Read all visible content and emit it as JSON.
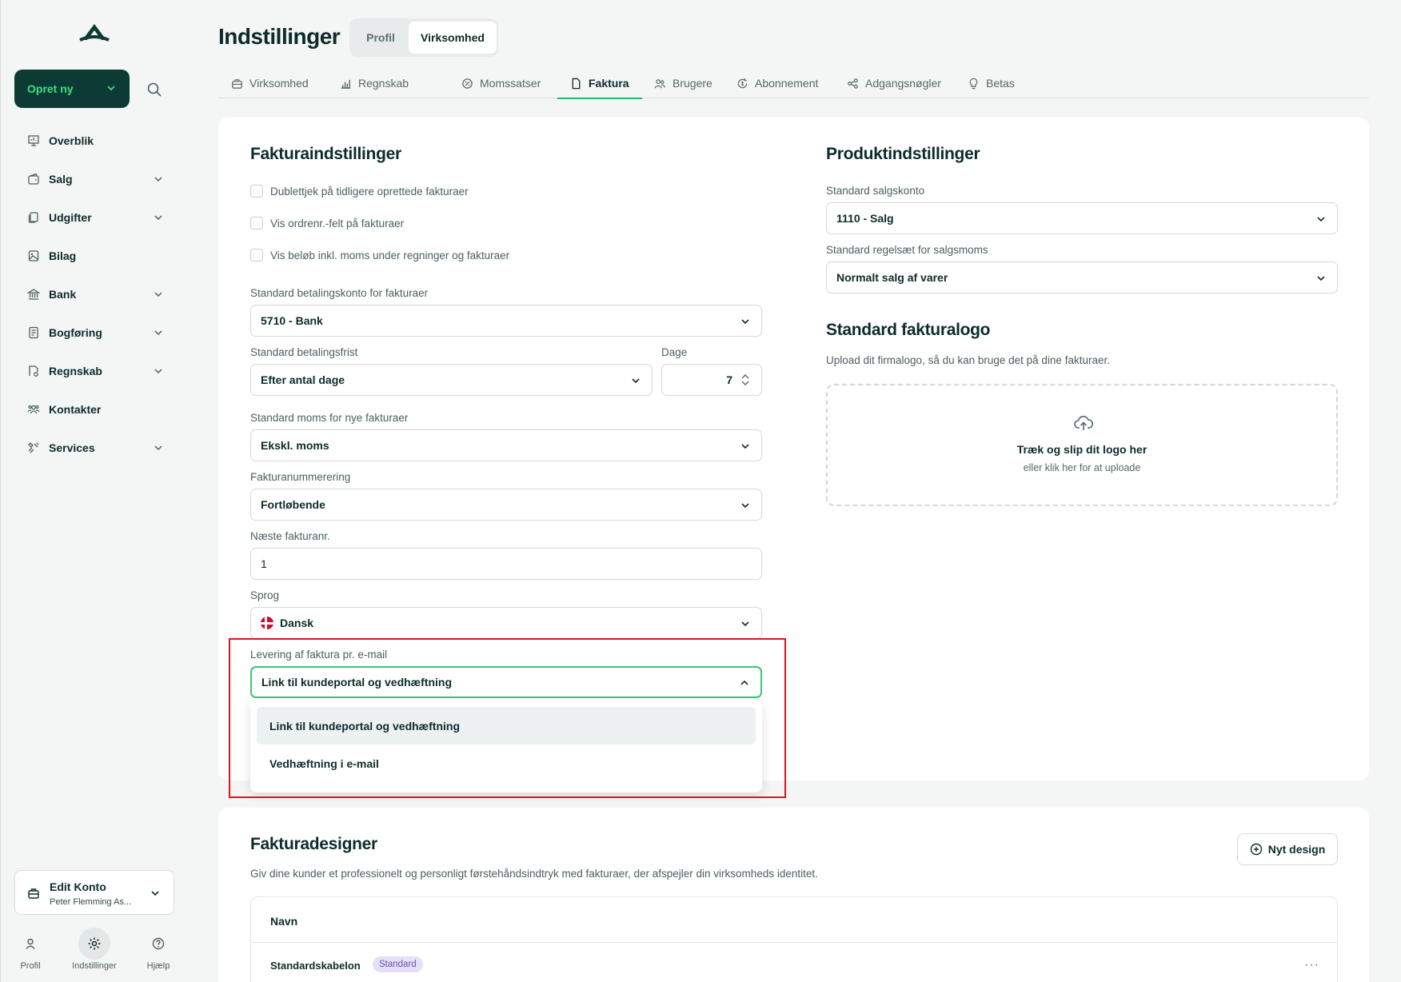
{
  "sidebar": {
    "create_label": "Opret ny",
    "items": [
      {
        "label": "Overblik",
        "icon": "presentation-icon",
        "has_chevron": false
      },
      {
        "label": "Salg",
        "icon": "wallet-icon",
        "has_chevron": true
      },
      {
        "label": "Udgifter",
        "icon": "receipt-icon",
        "has_chevron": true
      },
      {
        "label": "Bilag",
        "icon": "document-image-icon",
        "has_chevron": false
      },
      {
        "label": "Bank",
        "icon": "bank-icon",
        "has_chevron": true
      },
      {
        "label": "Bogføring",
        "icon": "ledger-icon",
        "has_chevron": true
      },
      {
        "label": "Regnskab",
        "icon": "report-icon",
        "has_chevron": true
      },
      {
        "label": "Kontakter",
        "icon": "contacts-icon",
        "has_chevron": false
      },
      {
        "label": "Services",
        "icon": "services-icon",
        "has_chevron": true
      }
    ],
    "account": {
      "name": "Edit Konto",
      "sub": "Peter Flemming As..."
    },
    "bottom": [
      {
        "label": "Profil",
        "icon": "user-icon"
      },
      {
        "label": "Indstillinger",
        "icon": "gear-icon"
      },
      {
        "label": "Hjælp",
        "icon": "help-icon"
      }
    ]
  },
  "header": {
    "title": "Indstillinger",
    "segments": [
      "Profil",
      "Virksomhed"
    ]
  },
  "tabs": [
    "Virksomhed",
    "Regnskab",
    "Momssatser",
    "Faktura",
    "Brugere",
    "Abonnement",
    "Adgangsnøgler",
    "Betas"
  ],
  "invoice": {
    "title": "Fakturaindstillinger",
    "checkboxes": [
      "Dublettjek på tidligere oprettede fakturaer",
      "Vis ordrenr.-felt på fakturaer",
      "Vis beløb inkl. moms under regninger og fakturaer"
    ],
    "pay_account_label": "Standard betalingskonto for fakturaer",
    "pay_account_value": "5710 -  Bank",
    "pay_term_label": "Standard betalingsfrist",
    "pay_term_value": "Efter antal dage",
    "days_label": "Dage",
    "days_value": "7",
    "vat_label": "Standard moms for nye fakturaer",
    "vat_value": "Ekskl. moms",
    "numbering_label": "Fakturanummerering",
    "numbering_value": "Fortløbende",
    "next_label": "Næste fakturanr.",
    "next_value": "1",
    "lang_label": "Sprog",
    "lang_value": "Dansk",
    "delivery_label": "Levering af faktura pr. e-mail",
    "delivery_value": "Link til kundeportal og vedhæftning",
    "delivery_options": [
      "Link til kundeportal og vedhæftning",
      "Vedhæftning i e-mail"
    ]
  },
  "product": {
    "title": "Produktindstillinger",
    "sales_account_label": "Standard salgskonto",
    "sales_account_value": "1110 -  Salg",
    "vat_rule_label": "Standard regelsæt for salgsmoms",
    "vat_rule_value": "Normalt salg af varer"
  },
  "logo": {
    "title": "Standard fakturalogo",
    "desc": "Upload dit firmalogo, så du kan bruge det på dine fakturaer.",
    "drop_title": "Træk og slip dit logo her",
    "drop_sub": "eller klik her for at uploade"
  },
  "designer": {
    "title": "Fakturadesigner",
    "desc": "Giv dine kunder et professionelt og personligt førstehåndsindtryk med fakturaer, der afspejler din virksomheds identitet.",
    "new_button": "Nyt design",
    "col_name": "Navn",
    "rows": [
      {
        "name": "Standardskabelon",
        "badge": "Standard"
      }
    ]
  },
  "colors": {
    "brand_dark": "#0c3b36",
    "brand_green": "#3ee07a",
    "accent": "#2bb36b",
    "highlight": "#e0151b"
  }
}
